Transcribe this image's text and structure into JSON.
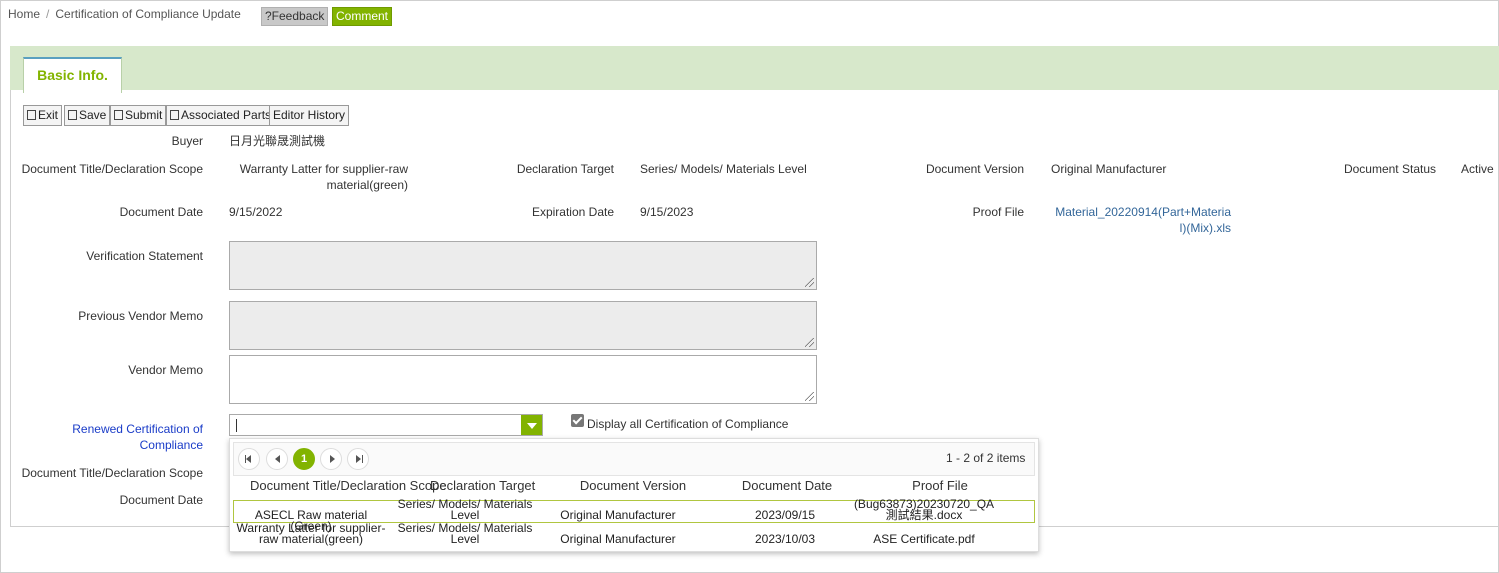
{
  "breadcrumb": {
    "home": "Home",
    "separator": "/",
    "current": "Certification of Compliance Update"
  },
  "header_buttons": {
    "feedback": "?Feedback",
    "comment": "Comment"
  },
  "tab": {
    "label": "Basic Info."
  },
  "toolbar": {
    "exit": "Exit",
    "save": "Save",
    "submit": "Submit",
    "associated_parts": "Associated Parts",
    "editor_history": "Editor History"
  },
  "form": {
    "buyer_label": "Buyer",
    "buyer_value": "日月光聯晟測試機",
    "doc_title_label": "Document Title/Declaration Scope",
    "doc_title_value": "Warranty Latter for supplier-raw material(green)",
    "decl_target_label": "Declaration Target",
    "decl_target_value": "Series/ Models/ Materials Level",
    "doc_version_label": "Document Version",
    "doc_version_value": "Original Manufacturer",
    "doc_status_label": "Document Status",
    "doc_status_value": "Active",
    "doc_date_label": "Document Date",
    "doc_date_value": "9/15/2022",
    "exp_date_label": "Expiration Date",
    "exp_date_value": "9/15/2023",
    "proof_file_label": "Proof File",
    "proof_file_value": "Material_20220914(Part+Material)(Mix).xls",
    "verification_label": "Verification Statement",
    "prev_memo_label": "Previous Vendor Memo",
    "vendor_memo_label": "Vendor Memo",
    "renewed_label": "Renewed Certification of Compliance",
    "display_all_label": "Display all Certification of Compliance",
    "doc_title_label2": "Document Title/Declaration Scope",
    "doc_date_label2": "Document Date"
  },
  "dropdown": {
    "pager": {
      "current_page": "1",
      "info": "1 - 2 of 2 items"
    },
    "columns": [
      "Document Title/Declaration Scope",
      "Declaration Target",
      "Document Version",
      "Document Date",
      "Proof File"
    ],
    "rows": [
      [
        "ASECL Raw material (Green)",
        "Series/ Models/ Materials Level",
        "Original Manufacturer",
        "2023/09/15",
        "(Bug63873)20230720_QA測試結果.docx"
      ],
      [
        "Warranty Latter for supplier-raw material(green)",
        "Series/ Models/ Materials Level",
        "Original Manufacturer",
        "2023/10/03",
        "ASE Certificate.pdf"
      ]
    ]
  },
  "colors": {
    "accent_green": "#82b300",
    "tab_band": "#d7e8cb",
    "link_blue": "#336699"
  }
}
